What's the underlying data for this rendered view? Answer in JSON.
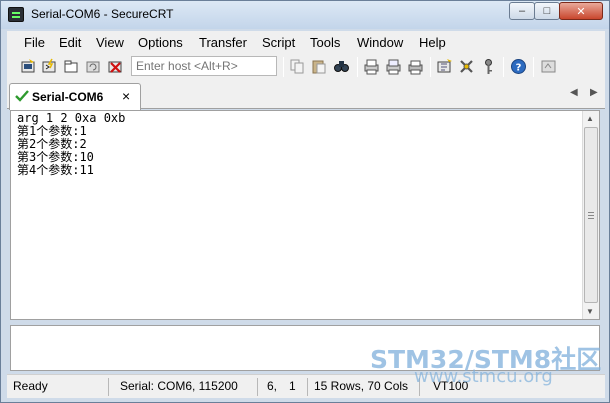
{
  "window": {
    "title": "Serial-COM6 - SecureCRT",
    "minimize": "–",
    "maximize": "□",
    "close": "✕"
  },
  "menu": {
    "items": [
      "File",
      "Edit",
      "View",
      "Options",
      "Transfer",
      "Script",
      "Tools",
      "Window",
      "Help"
    ]
  },
  "toolbar": {
    "host_placeholder": "Enter host <Alt+R>",
    "icons": [
      "connect-icon",
      "quick-connect-icon",
      "connect-in-tab-icon",
      "reconnect-icon",
      "disconnect-icon",
      "copy-icon",
      "paste-icon",
      "find-icon",
      "print-screen-icon",
      "print-selection-icon",
      "print-icon",
      "session-options-icon",
      "global-options-icon",
      "keymap-icon",
      "help-icon",
      "sftp-icon"
    ]
  },
  "tabs": {
    "active_label": "Serial-COM6",
    "close": "×",
    "prev": "◀",
    "next": "▶"
  },
  "terminal": {
    "lines": [
      "arg 1 2 0xa 0xb",
      "第1个参数:1",
      "第2个参数:2",
      "第3个参数:10",
      "第4个参数:11"
    ]
  },
  "status": {
    "state": "Ready",
    "connection": "Serial: COM6, 115200",
    "row": "6,",
    "col": "1",
    "size": "15 Rows, 70 Cols",
    "emulation": "VT100"
  },
  "watermark": {
    "main": "STM32/STM8社区",
    "sub": "www.stmcu.org"
  }
}
